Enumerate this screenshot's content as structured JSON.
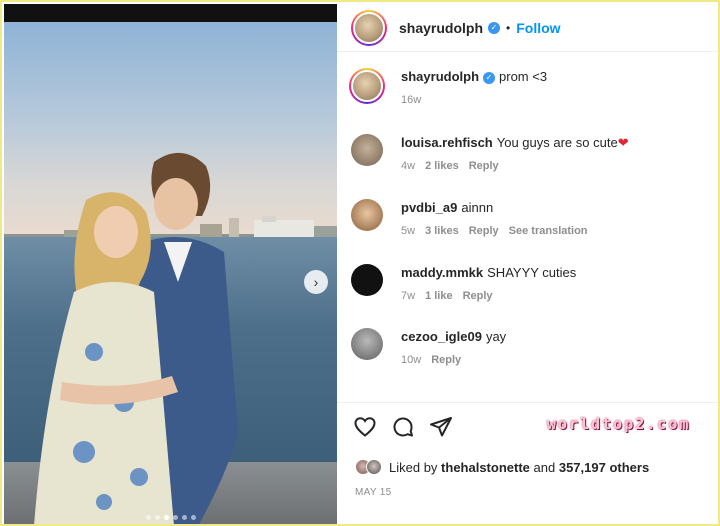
{
  "post": {
    "username": "shayrudolph",
    "verified": true,
    "follow_label": "Follow",
    "dot_separator": "•",
    "caption": "prom <3",
    "caption_age": "16w"
  },
  "comments": [
    {
      "username": "louisa.rehfisch",
      "text": "You guys are so cute",
      "emoji": "❤",
      "age": "4w",
      "likes": "2 likes",
      "reply": "Reply",
      "translation": ""
    },
    {
      "username": "pvdbi_a9",
      "text": "ainnn",
      "emoji": "",
      "age": "5w",
      "likes": "3 likes",
      "reply": "Reply",
      "translation": "See translation"
    },
    {
      "username": "maddy.mmkk",
      "text": "SHAYYY cuties",
      "emoji": "",
      "age": "7w",
      "likes": "1 like",
      "reply": "Reply",
      "translation": ""
    },
    {
      "username": "cezoo_igle09",
      "text": "yay",
      "emoji": "",
      "age": "10w",
      "likes": "",
      "reply": "Reply",
      "translation": ""
    }
  ],
  "actions": {
    "like_icon": "heart-outline-icon",
    "comment_icon": "speech-bubble-icon",
    "share_icon": "paper-plane-icon"
  },
  "likes": {
    "prefix": "Liked by",
    "user": "thehalstonette",
    "connector": "and",
    "others": "357,197 others"
  },
  "date": "MAY 15",
  "watermark": "worldtop2.com",
  "carousel": {
    "slide_count": 6,
    "active_index": 2,
    "next_icon": "chevron-right-icon"
  },
  "colors": {
    "accent": "#0095f6",
    "verified": "#3897f0",
    "heart": "#e0243a",
    "frame": "#efe98a"
  }
}
